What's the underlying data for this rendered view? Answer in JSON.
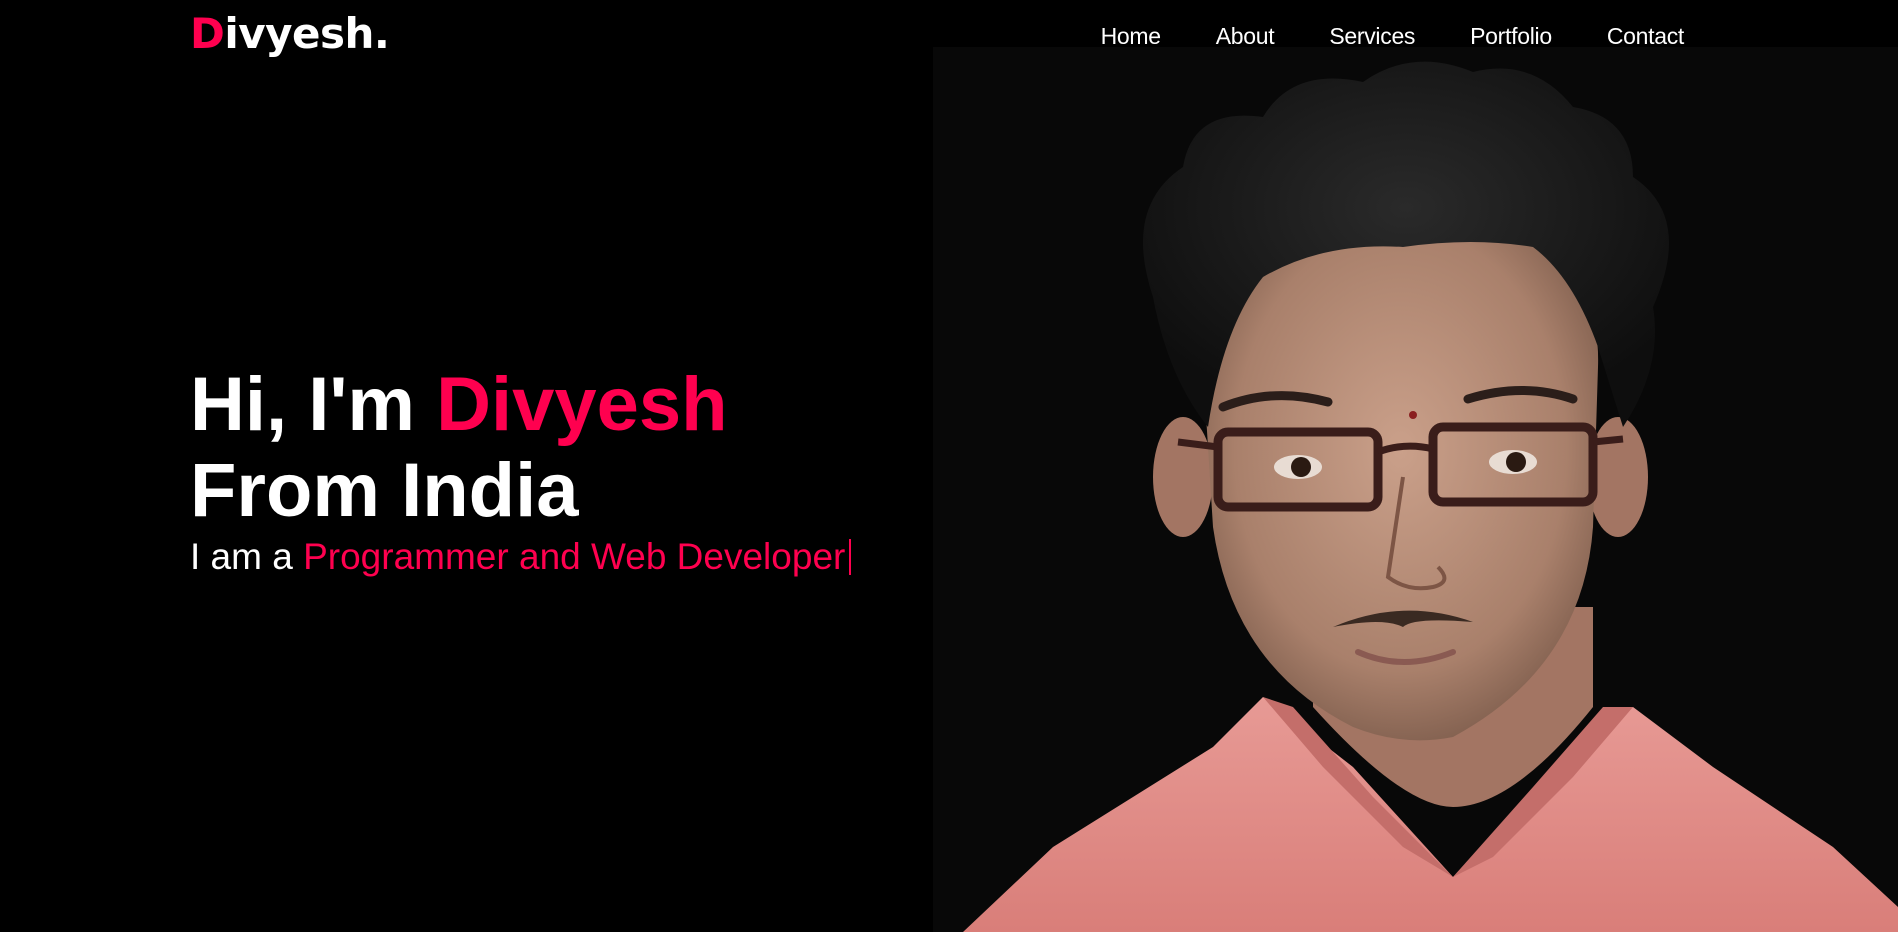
{
  "header": {
    "logo_initial": "D",
    "logo_rest": "ivyesh.",
    "nav": [
      {
        "label": "Home"
      },
      {
        "label": "About"
      },
      {
        "label": "Services"
      },
      {
        "label": "Portfolio"
      },
      {
        "label": "Contact"
      }
    ]
  },
  "hero": {
    "greeting_prefix": "Hi, I'm ",
    "name": "Divyesh",
    "location_line": "From India",
    "sub_prefix": "I am a ",
    "role": "Programmer and Web Developer"
  },
  "photo": {
    "icon": "profile-photo"
  },
  "colors": {
    "accent": "#ff004f",
    "background": "#000000",
    "text": "#ffffff",
    "photo_background": "#080808"
  }
}
